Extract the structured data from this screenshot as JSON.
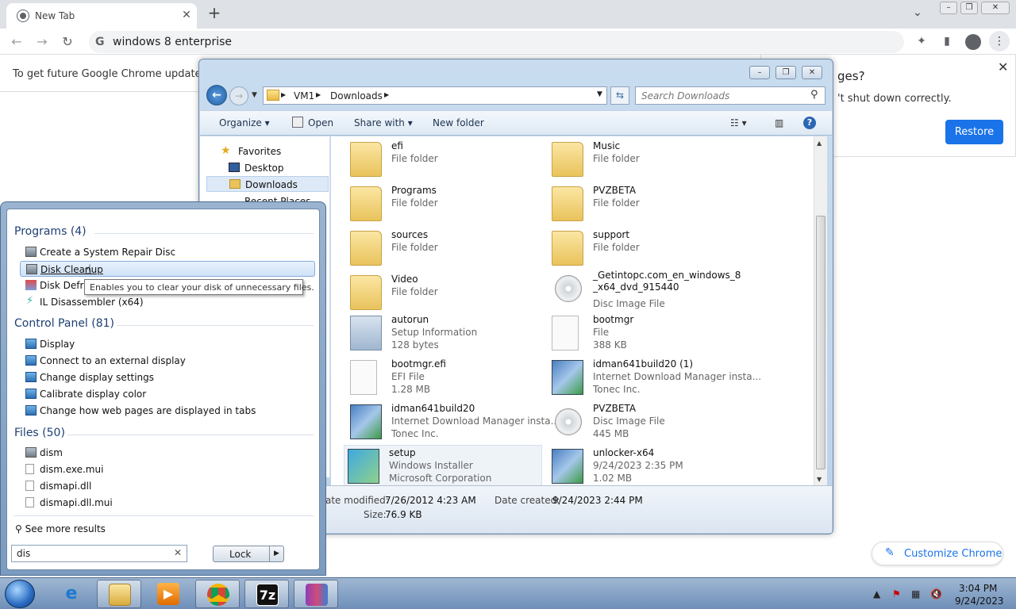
{
  "chrome": {
    "tab_title": "New Tab",
    "tab_close": "✕",
    "new_tab": "+",
    "tab_search": "⌄",
    "omnibox_text": "windows 8 enterprise",
    "update_text": "To get future Google Chrome updates, yo",
    "restore_title": "ges?",
    "restore_body": "'t shut down correctly.",
    "restore_button": "Restore",
    "restore_close": "✕",
    "customize_label": "Customize Chrome"
  },
  "explorer": {
    "breadcrumb": [
      "VM1",
      "Downloads"
    ],
    "search_placeholder": "Search Downloads",
    "commands": {
      "organize": "Organize ▾",
      "open": "Open",
      "share": "Share with ▾",
      "new_folder": "New folder"
    },
    "nav": [
      {
        "label": "Favorites"
      },
      {
        "label": "Desktop"
      },
      {
        "label": "Downloads"
      },
      {
        "label": "Recent Places"
      }
    ],
    "files": [
      {
        "name": "efi",
        "line2": "File folder",
        "line3": "",
        "icon": "folder-icon"
      },
      {
        "name": "Music",
        "line2": "File folder",
        "line3": "",
        "icon": "folder-icon"
      },
      {
        "name": "Programs",
        "line2": "File folder",
        "line3": "",
        "icon": "folder-icon"
      },
      {
        "name": "PVZBETA",
        "line2": "File folder",
        "line3": "",
        "icon": "folder-icon"
      },
      {
        "name": "sources",
        "line2": "File folder",
        "line3": "",
        "icon": "folder-icon"
      },
      {
        "name": "support",
        "line2": "File folder",
        "line3": "",
        "icon": "folder-icon"
      },
      {
        "name": "Video",
        "line2": "File folder",
        "line3": "",
        "icon": "folder-icon"
      },
      {
        "name": "_Getintopc.com_en_windows_8_x64_dvd_915440",
        "line2": "",
        "line3": "Disc Image File",
        "icon": "disc-icon"
      },
      {
        "name": "autorun",
        "line2": "Setup Information",
        "line3": "128 bytes",
        "icon": "setup-info-icon"
      },
      {
        "name": "bootmgr",
        "line2": "File",
        "line3": "388 KB",
        "icon": "file-icon"
      },
      {
        "name": "bootmgr.efi",
        "line2": "EFI File",
        "line3": "1.28 MB",
        "icon": "file-icon"
      },
      {
        "name": "idman641build20 (1)",
        "line2": "Internet Download Manager insta...",
        "line3": "Tonec Inc.",
        "icon": "installer-icon"
      },
      {
        "name": "idman641build20",
        "line2": "Internet Download Manager insta...",
        "line3": "Tonec Inc.",
        "icon": "installer-icon"
      },
      {
        "name": "PVZBETA",
        "line2": "Disc Image File",
        "line3": "445 MB",
        "icon": "disc-icon"
      },
      {
        "name": "setup",
        "line2": "Windows Installer",
        "line3": "Microsoft Corporation",
        "icon": "installer-icon"
      },
      {
        "name": "unlocker-x64",
        "line2": "9/24/2023 2:35 PM",
        "line3": "1.02 MB",
        "icon": "installer-icon"
      }
    ],
    "details": {
      "modified_label": "ate modified:",
      "modified_value": "7/26/2012 4:23 AM",
      "created_label": "Date created:",
      "created_value": "9/24/2023 2:44 PM",
      "size_label": "Size:",
      "size_value": "76.9 KB"
    }
  },
  "startmenu": {
    "programs_header": "Programs (4)",
    "programs": [
      {
        "label": "Create a System Repair Disc"
      },
      {
        "label": "Disk Cleanup"
      },
      {
        "label": "Disk Defragmenter"
      },
      {
        "label": "IL Disassembler (x64)"
      }
    ],
    "tooltip": "Enables you to clear your disk of unnecessary files.",
    "control_header": "Control Panel (81)",
    "control": [
      {
        "label": "Display"
      },
      {
        "label": "Connect to an external display"
      },
      {
        "label": "Change display settings"
      },
      {
        "label": "Calibrate display color"
      },
      {
        "label": "Change how web pages are displayed in tabs"
      }
    ],
    "files_header": "Files (50)",
    "files": [
      {
        "label": "dism"
      },
      {
        "label": "dism.exe.mui"
      },
      {
        "label": "dismapi.dll"
      },
      {
        "label": "dismapi.dll.mui"
      }
    ],
    "see_more": "See more results",
    "search_value": "dis",
    "search_clear": "✕",
    "lock_label": "Lock",
    "lock_arrow": "▶"
  },
  "taskbar": {
    "time": "3:04 PM",
    "date": "9/24/2023",
    "sevenzip_label": "7z"
  }
}
